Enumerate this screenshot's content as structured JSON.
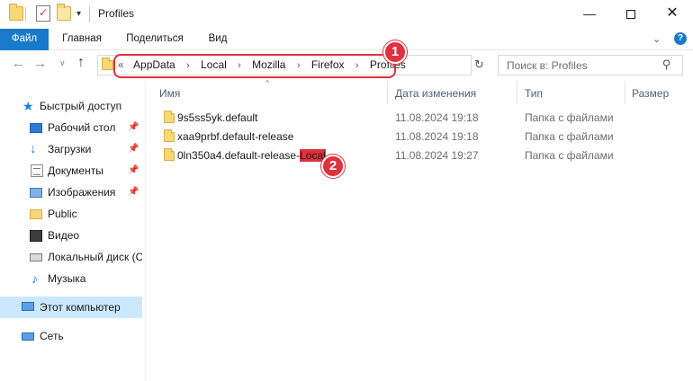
{
  "window": {
    "title": "Profiles",
    "minimize_glyph": "—",
    "close_glyph": "✕"
  },
  "quick_access_toolbar": {
    "dropdown_glyph": "▾"
  },
  "ribbon": {
    "tabs": [
      {
        "label": "Файл"
      },
      {
        "label": "Главная"
      },
      {
        "label": "Поделиться"
      },
      {
        "label": "Вид"
      }
    ],
    "expand_glyph": "⌄",
    "help_glyph": "?"
  },
  "navigation": {
    "back_glyph": "←",
    "forward_glyph": "→",
    "recent_glyph": "∨",
    "up_glyph": "↑"
  },
  "address_bar": {
    "overflow_glyph": "«",
    "separator_glyph": "›",
    "breadcrumbs": [
      "AppData",
      "Local",
      "Mozilla",
      "Firefox",
      "Profiles"
    ],
    "dropdown_glyph": "∨",
    "refresh_glyph": "↻"
  },
  "search": {
    "placeholder": "Поиск в: Profiles",
    "icon": "search-icon",
    "icon_glyph": "⚲"
  },
  "annotations": [
    {
      "number": "1"
    },
    {
      "number": "2"
    }
  ],
  "sidebar": {
    "pin_glyph": "📌",
    "items": [
      {
        "label": "Быстрый доступ",
        "icon": "star-icon",
        "glyph": "★"
      },
      {
        "label": "Рабочий стол",
        "icon": "desktop-icon",
        "pinned": true
      },
      {
        "label": "Загрузки",
        "icon": "download-icon",
        "glyph": "↓",
        "pinned": true
      },
      {
        "label": "Документы",
        "icon": "documents-icon",
        "pinned": true
      },
      {
        "label": "Изображения",
        "icon": "pictures-icon",
        "pinned": true
      },
      {
        "label": "Public",
        "icon": "folder-icon"
      },
      {
        "label": "Видео",
        "icon": "video-icon"
      },
      {
        "label": "Локальный диск (C",
        "icon": "disk-icon"
      },
      {
        "label": "Музыка",
        "icon": "music-icon",
        "glyph": "♪"
      },
      {
        "label": "Этот компьютер",
        "icon": "computer-icon",
        "selected": true
      },
      {
        "label": "Сеть",
        "icon": "network-icon"
      }
    ]
  },
  "file_list": {
    "sort_glyph": "^",
    "columns": [
      "Имя",
      "Дата изменения",
      "Тип",
      "Размер"
    ],
    "rows": [
      {
        "name": "9s5ss5yk.default",
        "date": "11.08.2024 19:18",
        "type": "Папка с файлами"
      },
      {
        "name": "xaa9prbf.default-release",
        "date": "11.08.2024 19:18",
        "type": "Папка с файлами"
      },
      {
        "name_main": "0ln350a4.default-release-",
        "name_highlight": "Local",
        "date": "11.08.2024 19:27",
        "type": "Папка с файлами"
      }
    ]
  },
  "colors": {
    "accent": "#1979ca",
    "annotation": "#e0313d",
    "selection": "#cce8ff",
    "folder": "#f8d775"
  }
}
